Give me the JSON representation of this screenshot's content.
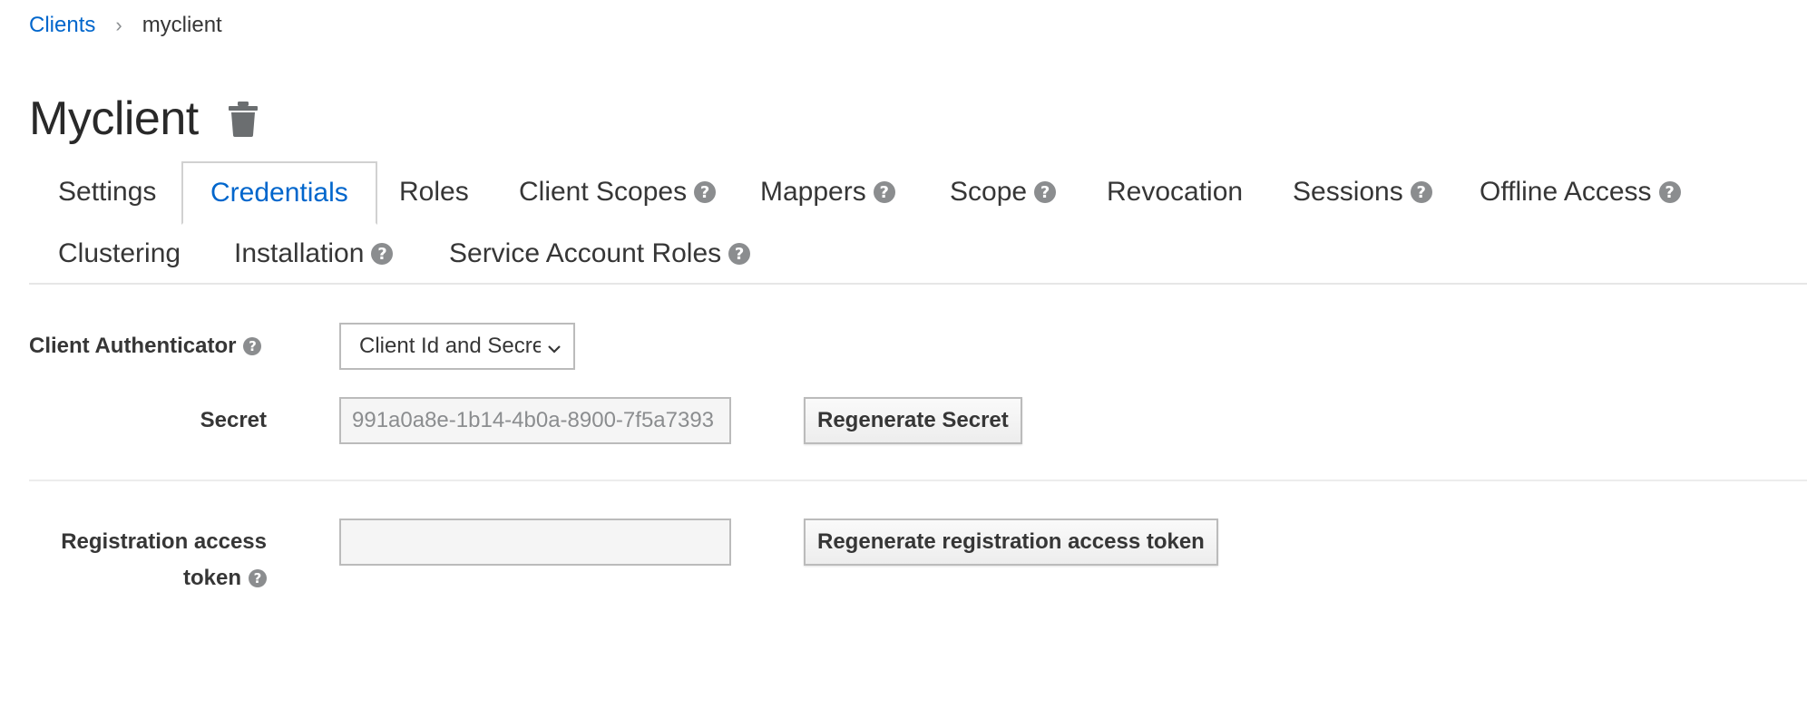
{
  "breadcrumb": {
    "parent": "Clients",
    "separator": "›",
    "current": "myclient"
  },
  "page": {
    "title": "Myclient",
    "delete_icon": "trash-icon"
  },
  "tabs": [
    {
      "label": "Settings",
      "help": false,
      "active": false
    },
    {
      "label": "Credentials",
      "help": false,
      "active": true
    },
    {
      "label": "Roles",
      "help": false,
      "active": false
    },
    {
      "label": "Client Scopes",
      "help": true,
      "active": false
    },
    {
      "label": "Mappers",
      "help": true,
      "active": false
    },
    {
      "label": "Scope",
      "help": true,
      "active": false
    },
    {
      "label": "Revocation",
      "help": false,
      "active": false
    },
    {
      "label": "Sessions",
      "help": true,
      "active": false
    },
    {
      "label": "Offline Access",
      "help": true,
      "active": false
    },
    {
      "label": "Clustering",
      "help": false,
      "active": false
    },
    {
      "label": "Installation",
      "help": true,
      "active": false
    },
    {
      "label": "Service Account Roles",
      "help": true,
      "active": false
    }
  ],
  "help_glyph": "?",
  "form": {
    "client_authenticator": {
      "label": "Client Authenticator",
      "selected": "Client Id and Secret"
    },
    "secret": {
      "label": "Secret",
      "value": "991a0a8e-1b14-4b0a-8900-7f5a7393",
      "button": "Regenerate Secret"
    },
    "registration_token": {
      "label_line1": "Registration access",
      "label_line2": "token",
      "value": "",
      "button": "Regenerate registration access token"
    }
  },
  "colors": {
    "link": "#0066cc",
    "text": "#363636",
    "help_icon": "#8b8d8f"
  }
}
